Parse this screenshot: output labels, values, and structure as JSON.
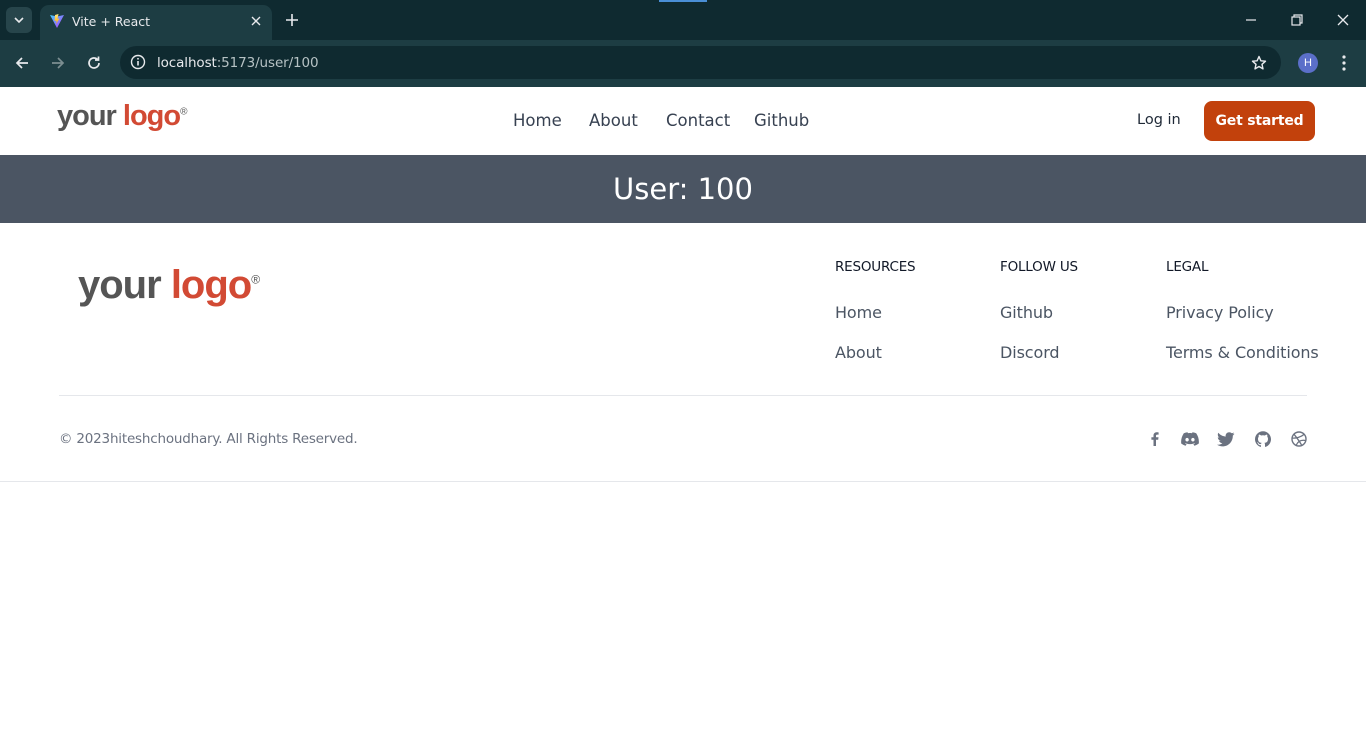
{
  "browser": {
    "tab_title": "Vite + React",
    "url_host": "localhost",
    "url_rest": ":5173/user/100",
    "profile_initial": "H",
    "icons": {
      "tab_menu": "chevron-down-icon",
      "favicon": "vite-logo-icon",
      "close_tab": "close-icon",
      "new_tab": "plus-icon",
      "back": "arrow-left-icon",
      "forward": "arrow-right-icon",
      "reload": "reload-icon",
      "site_info": "info-icon",
      "bookmark": "star-icon",
      "menu": "kebab-menu-icon",
      "minimize": "minimize-icon",
      "restore": "restore-icon",
      "close_window": "close-icon"
    }
  },
  "header": {
    "logo": {
      "part1": "your",
      "part2": "logo",
      "mark": "®"
    },
    "nav": [
      "Home",
      "About",
      "Contact",
      "Github"
    ],
    "login_label": "Log in",
    "cta_label": "Get started",
    "cta_color": "#c2410c"
  },
  "banner": {
    "text": "User: 100",
    "background": "#4b5563"
  },
  "footer": {
    "logo": {
      "part1": "your",
      "part2": "logo",
      "mark": "®"
    },
    "columns": [
      {
        "title": "RESOURCES",
        "links": [
          "Home",
          "About"
        ]
      },
      {
        "title": "FOLLOW US",
        "links": [
          "Github",
          "Discord"
        ]
      },
      {
        "title": "LEGAL",
        "links": [
          "Privacy Policy",
          "Terms & Conditions"
        ]
      }
    ],
    "copyright": "© 2023hiteshchoudhary. All Rights Reserved.",
    "social_icons": [
      "facebook-icon",
      "discord-icon",
      "twitter-icon",
      "github-icon",
      "dribbble-icon"
    ]
  },
  "colors": {
    "brand_grey": "#555555",
    "brand_red": "#d24a34",
    "chrome_dark": "#0f2a30",
    "chrome_toolbar": "#1d3d43"
  }
}
